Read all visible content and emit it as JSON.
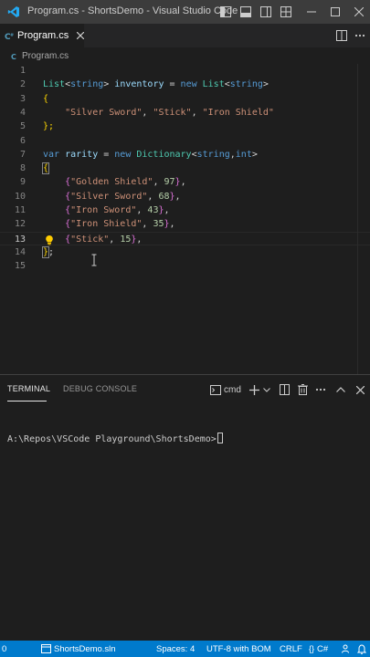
{
  "window": {
    "title": "Program.cs - ShortsDemo - Visual Studio Code"
  },
  "tab": {
    "label": "Program.cs",
    "icon": "csharp-file-icon"
  },
  "breadcrumb": {
    "file": "Program.cs"
  },
  "editor": {
    "current_line": 13,
    "lines": [
      {
        "n": "1"
      },
      {
        "n": "2"
      },
      {
        "n": "3"
      },
      {
        "n": "4"
      },
      {
        "n": "5"
      },
      {
        "n": "6"
      },
      {
        "n": "7"
      },
      {
        "n": "8"
      },
      {
        "n": "9"
      },
      {
        "n": "10"
      },
      {
        "n": "11"
      },
      {
        "n": "12"
      },
      {
        "n": "13"
      },
      {
        "n": "14"
      },
      {
        "n": "15"
      }
    ],
    "tokens": {
      "l2": {
        "t1": "List",
        "t2": "<",
        "t3": "string",
        "t4": "> ",
        "t5": "inventory",
        "t6": " = ",
        "t7": "new",
        "t8": " ",
        "t9": "List",
        "t10": "<",
        "t11": "string",
        "t12": ">"
      },
      "l3": {
        "t1": "{"
      },
      "l4": {
        "t1": "    ",
        "t2": "\"Silver Sword\"",
        "t3": ", ",
        "t4": "\"Stick\"",
        "t5": ", ",
        "t6": "\"Iron Shield\""
      },
      "l5": {
        "t1": "};"
      },
      "l7": {
        "t1": "var",
        "t2": " ",
        "t3": "rarity",
        "t4": " = ",
        "t5": "new",
        "t6": " ",
        "t7": "Dictionary",
        "t8": "<",
        "t9": "string",
        "t10": ",",
        "t11": "int",
        "t12": ">"
      },
      "l8": {
        "t1": "{"
      },
      "l9": {
        "t1": "    ",
        "t2": "{",
        "t3": "\"Golden Shield\"",
        "t4": ", ",
        "t5": "97",
        "t6": "}",
        "t7": ","
      },
      "l10": {
        "t1": "    ",
        "t2": "{",
        "t3": "\"Silver Sword\"",
        "t4": ", ",
        "t5": "68",
        "t6": "}",
        "t7": ","
      },
      "l11": {
        "t1": "    ",
        "t2": "{",
        "t3": "\"Iron Sword\"",
        "t4": ", ",
        "t5": "43",
        "t6": "}",
        "t7": ","
      },
      "l12": {
        "t1": "    ",
        "t2": "{",
        "t3": "\"Iron Shield\"",
        "t4": ", ",
        "t5": "35",
        "t6": "}",
        "t7": ","
      },
      "l13": {
        "t1": "    ",
        "t2": "{",
        "t3": "\"Stick\"",
        "t4": ", ",
        "t5": "15",
        "t6": "}",
        "t7": ","
      },
      "l14": {
        "t1": "}",
        "t2": ";"
      }
    }
  },
  "panel": {
    "tabs": [
      "TERMINAL",
      "DEBUG CONSOLE"
    ],
    "shell_label": "cmd",
    "terminal_prompt": "A:\\Repos\\VSCode Playground\\ShortsDemo>"
  },
  "statusbar": {
    "left_count": "0",
    "solution": "ShortsDemo.sln",
    "spaces": "Spaces: 4",
    "encoding": "UTF-8 with BOM",
    "eol": "CRLF",
    "language": "C#"
  },
  "colors": {
    "statusbar": "#007acc",
    "titlebar": "#3c3c3c",
    "editor_bg": "#1e1e1e",
    "keyword": "#569cd6",
    "type": "#4ec9b0",
    "string": "#ce9178",
    "number": "#b5cea8"
  }
}
